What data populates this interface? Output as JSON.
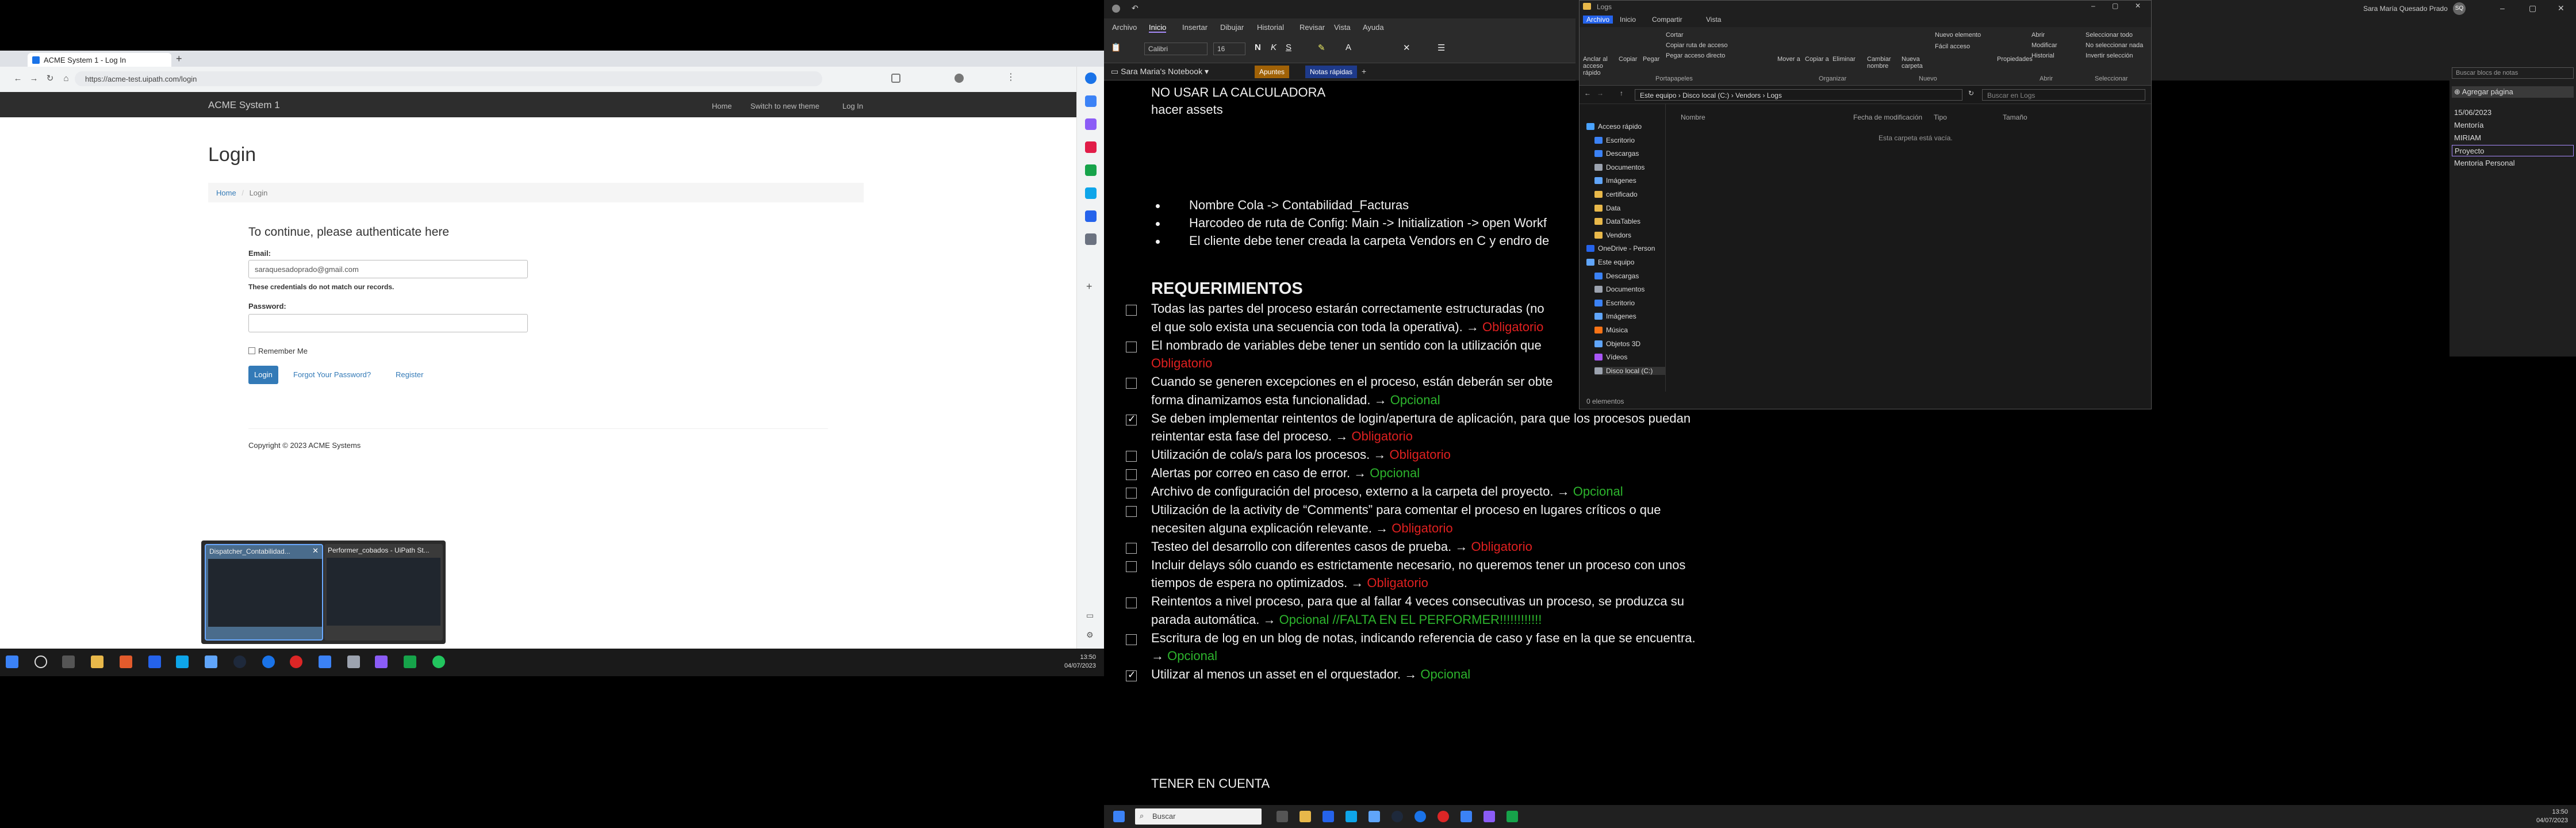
{
  "browser": {
    "tab_title": "ACME System 1 - Log In",
    "new_tab": "+",
    "url": "https://acme-test.uipath.com/login"
  },
  "acme": {
    "brand": "ACME System 1",
    "nav": [
      "Home",
      "Switch to new theme",
      "Log In"
    ],
    "heading": "Login",
    "breadcrumb": [
      "Home",
      "Login"
    ],
    "subheading": "To continue, please authenticate here",
    "email_label": "Email:",
    "email_value": "saraquesadoprado@gmail.com",
    "error": "These credentials do not match our records.",
    "password_label": "Password:",
    "remember": "Remember Me",
    "login_btn": "Login",
    "forgot": "Forgot Your Password?",
    "register": "Register",
    "copyright": "Copyright © 2023 ACME Systems"
  },
  "thumbnails": [
    {
      "title": "Dispatcher_Contabilidad..."
    },
    {
      "title": "Performer_cobados - UiPath St..."
    }
  ],
  "left_clock": {
    "time": "13:50",
    "date": "04/07/2023"
  },
  "onenote": {
    "ribbon_tabs": [
      "Archivo",
      "Inicio",
      "Insertar",
      "Dibujar",
      "Historial",
      "Revisar",
      "Vista",
      "Ayuda"
    ],
    "font": "Calibri",
    "size": "16",
    "notebook": "Sara Maria's Notebook",
    "section_tabs": [
      "Apuntes",
      "Notas rápidas"
    ],
    "add_page": "Agregar página",
    "search": "Buscar blocs de notas",
    "pages": [
      "15/06/2023",
      "Mentoría",
      "MIRIAM",
      "Proyecto",
      "Mentoria Personal"
    ],
    "lines_top": [
      "NO USAR LA CALCULADORA",
      "hacer assets"
    ],
    "bullets": [
      "Nombre Cola -> Contabilidad_Facturas",
      "Harcodeo de ruta de Config: Main -> Initialization -> open Workf",
      "El cliente debe tener creada la carpeta Vendors en C y endro de"
    ],
    "req_title": "REQUERIMIENTOS",
    "reqs": [
      {
        "checked": false,
        "lines": [
          "Todas las partes del proceso estarán correctamente estructuradas (no",
          "el que solo exista una secuencia con toda la operativa). → "
        ],
        "tag": "Obligatorio",
        "tagtype": "obl"
      },
      {
        "checked": false,
        "lines": [
          "El nombrado de variables debe tener un sentido con la utilización que",
          ""
        ],
        "tag": "Obligatorio",
        "tagtype": "obl"
      },
      {
        "checked": false,
        "lines": [
          "Cuando se generen excepciones en el proceso, están deberán ser obte",
          "forma dinamizamos esta funcionalidad. → "
        ],
        "tag": "Opcional",
        "tagtype": "opc"
      },
      {
        "checked": true,
        "lines": [
          "Se deben implementar reintentos de login/apertura de aplicación, para que los procesos puedan",
          "reintentar esta fase del proceso. → "
        ],
        "tag": "Obligatorio",
        "tagtype": "obl"
      },
      {
        "checked": false,
        "lines": [
          "Utilización de cola/s para los procesos. → "
        ],
        "tag": "Obligatorio",
        "tagtype": "obl"
      },
      {
        "checked": false,
        "lines": [
          " Alertas por correo en caso de error. → "
        ],
        "tag": "Opcional",
        "tagtype": "opc"
      },
      {
        "checked": false,
        "lines": [
          " Archivo de configuración del proceso, externo a la carpeta del proyecto. → "
        ],
        "tag": "Opcional",
        "tagtype": "opc"
      },
      {
        "checked": false,
        "lines": [
          "Utilización de la activity de “Comments” para comentar el proceso en lugares críticos o que",
          "necesiten alguna explicación relevante. → "
        ],
        "tag": "Obligatorio",
        "tagtype": "obl"
      },
      {
        "checked": false,
        "lines": [
          "Testeo del desarrollo con diferentes casos de prueba. → "
        ],
        "tag": "Obligatorio",
        "tagtype": "obl"
      },
      {
        "checked": false,
        "lines": [
          "Incluir delays sólo cuando es estrictamente necesario, no queremos tener un proceso con unos",
          "tiempos de espera no optimizados. → "
        ],
        "tag": "Obligatorio",
        "tagtype": "obl"
      },
      {
        "checked": false,
        "lines": [
          "Reintentos a nivel proceso, para que al fallar 4 veces consecutivas un proceso, se produzca su",
          "parada automática. → "
        ],
        "tag": "Opcional //FALTA EN EL PERFORMER!!!!!!!!!!!!",
        "tagtype": "opc"
      },
      {
        "checked": false,
        "lines": [
          "Escritura de log en un blog de notas, indicando referencia de caso y fase en la que se encuentra.",
          "→ "
        ],
        "tag": "Opcional",
        "tagtype": "opc"
      },
      {
        "checked": true,
        "lines": [
          " Utilizar al menos un asset en el orquestador. → "
        ],
        "tag": "Opcional",
        "tagtype": "opc"
      }
    ],
    "footer_line": "TENER EN CUENTA",
    "user": "Sara María Quesado Prado",
    "user_initials": "SQ",
    "taskbar_search": "Buscar",
    "clock": {
      "time": "13:50",
      "date": "04/07/2023"
    }
  },
  "explorer": {
    "title": "Logs",
    "tabs": [
      "Archivo",
      "Inicio",
      "Compartir",
      "Vista"
    ],
    "groups": [
      "Portapapeles",
      "Organizar",
      "Nuevo",
      "Abrir",
      "Seleccionar"
    ],
    "ribbon_items": [
      "Anclar al acceso rápido",
      "Copiar",
      "Pegar",
      "Cortar",
      "Copiar ruta de acceso",
      "Pegar acceso directo",
      "Mover a",
      "Copiar a",
      "Eliminar",
      "Cambiar nombre",
      "Nueva carpeta",
      "Nuevo elemento",
      "Fácil acceso",
      "Propiedades",
      "Abrir",
      "Modificar",
      "Historial",
      "Seleccionar todo",
      "No seleccionar nada",
      "Invertir selección"
    ],
    "address": [
      "Este equipo",
      "Disco local (C:)",
      "Vendors",
      "Logs"
    ],
    "search": "Buscar en Logs",
    "nav": [
      {
        "label": "Acceso rápido",
        "color": "#4aa3ff"
      },
      {
        "label": "Escritorio",
        "color": "#3b82f6"
      },
      {
        "label": "Descargas",
        "color": "#3b82f6"
      },
      {
        "label": "Documentos",
        "color": "#9ca3af"
      },
      {
        "label": "Imágenes",
        "color": "#60a5fa"
      },
      {
        "label": "certificado",
        "color": "#e8b84a"
      },
      {
        "label": "Data",
        "color": "#e8b84a"
      },
      {
        "label": "DataTables",
        "color": "#e8b84a"
      },
      {
        "label": "Vendors",
        "color": "#e8b84a"
      },
      {
        "label": "OneDrive - Person",
        "color": "#2563eb"
      },
      {
        "label": "Este equipo",
        "color": "#60a5fa"
      },
      {
        "label": "Descargas",
        "color": "#3b82f6"
      },
      {
        "label": "Documentos",
        "color": "#9ca3af"
      },
      {
        "label": "Escritorio",
        "color": "#3b82f6"
      },
      {
        "label": "Imágenes",
        "color": "#60a5fa"
      },
      {
        "label": "Música",
        "color": "#f97316"
      },
      {
        "label": "Objetos 3D",
        "color": "#60a5fa"
      },
      {
        "label": "Vídeos",
        "color": "#a855f7"
      },
      {
        "label": "Disco local (C:)",
        "color": "#9ca3af"
      }
    ],
    "columns": [
      "Nombre",
      "Fecha de modificación",
      "Tipo",
      "Tamaño"
    ],
    "empty": "Esta carpeta está vacía.",
    "status": "0 elementos"
  }
}
